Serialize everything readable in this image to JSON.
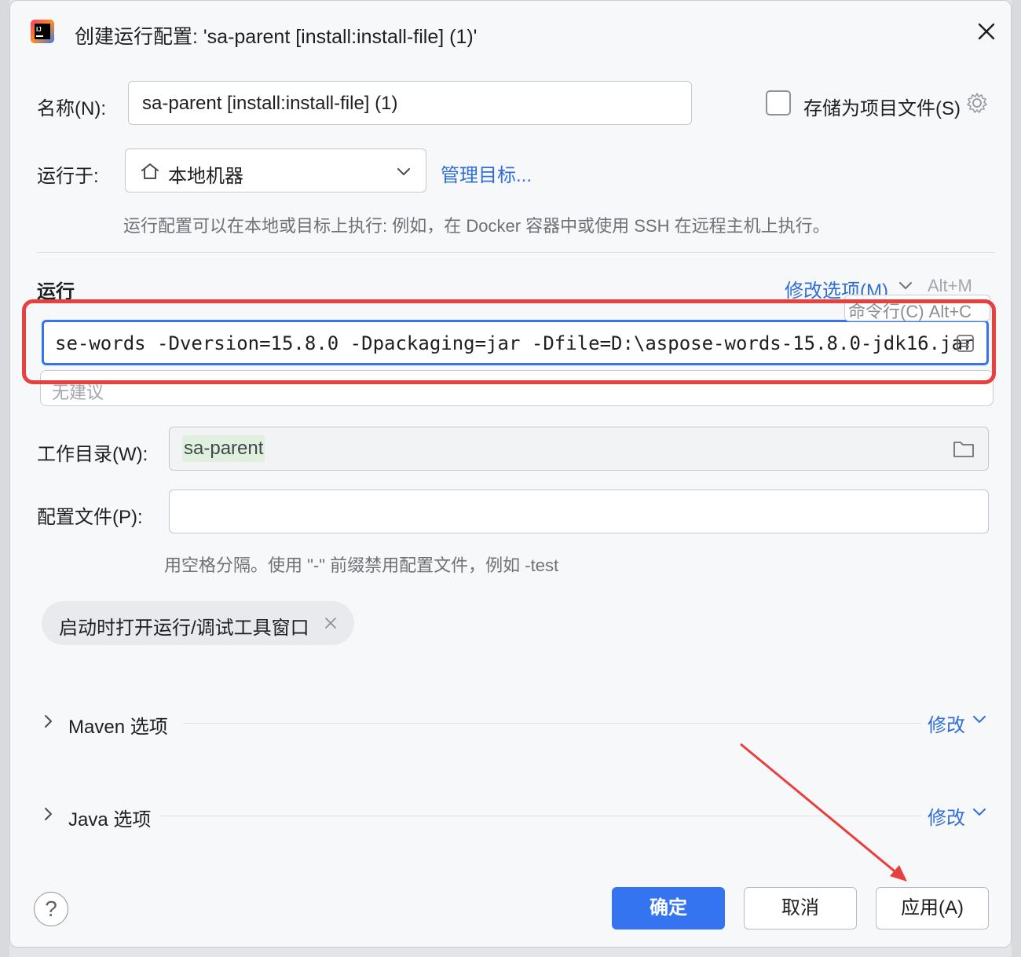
{
  "window": {
    "title": "创建运行配置: 'sa-parent [install:install-file] (1)'"
  },
  "name_row": {
    "label": "名称(N):",
    "value": "sa-parent [install:install-file] (1)",
    "store_label": "存储为项目文件(S)",
    "store_checked": false
  },
  "run_on": {
    "label": "运行于:",
    "selected": "本地机器",
    "manage_link": "管理目标...",
    "hint": "运行配置可以在本地或目标上执行: 例如，在 Docker 容器中或使用 SSH 在远程主机上执行。"
  },
  "run_section": {
    "title": "运行",
    "modify_options": "修改选项(M)",
    "modify_shortcut": "Alt+M",
    "tooltip": "命令行(C) Alt+C",
    "command": "se-words -Dversion=15.8.0 -Dpackaging=jar -Dfile=D:\\aspose-words-15.8.0-jdk16.jar",
    "suggestion": "无建议"
  },
  "working_dir": {
    "label": "工作目录(W):",
    "value": "sa-parent"
  },
  "profiles": {
    "label": "配置文件(P):",
    "value": "",
    "hint": "用空格分隔。使用 \"-\" 前缀禁用配置文件，例如 -test"
  },
  "chip": {
    "label": "启动时打开运行/调试工具窗口"
  },
  "maven": {
    "label": "Maven 选项",
    "modify": "修改"
  },
  "java": {
    "label": "Java 选项",
    "modify": "修改"
  },
  "buttons": {
    "ok": "确定",
    "cancel": "取消",
    "apply": "应用(A)",
    "help": "?"
  },
  "colors": {
    "accent": "#3574f0",
    "link": "#2f6ed8",
    "annotation_red": "#e8403f"
  }
}
